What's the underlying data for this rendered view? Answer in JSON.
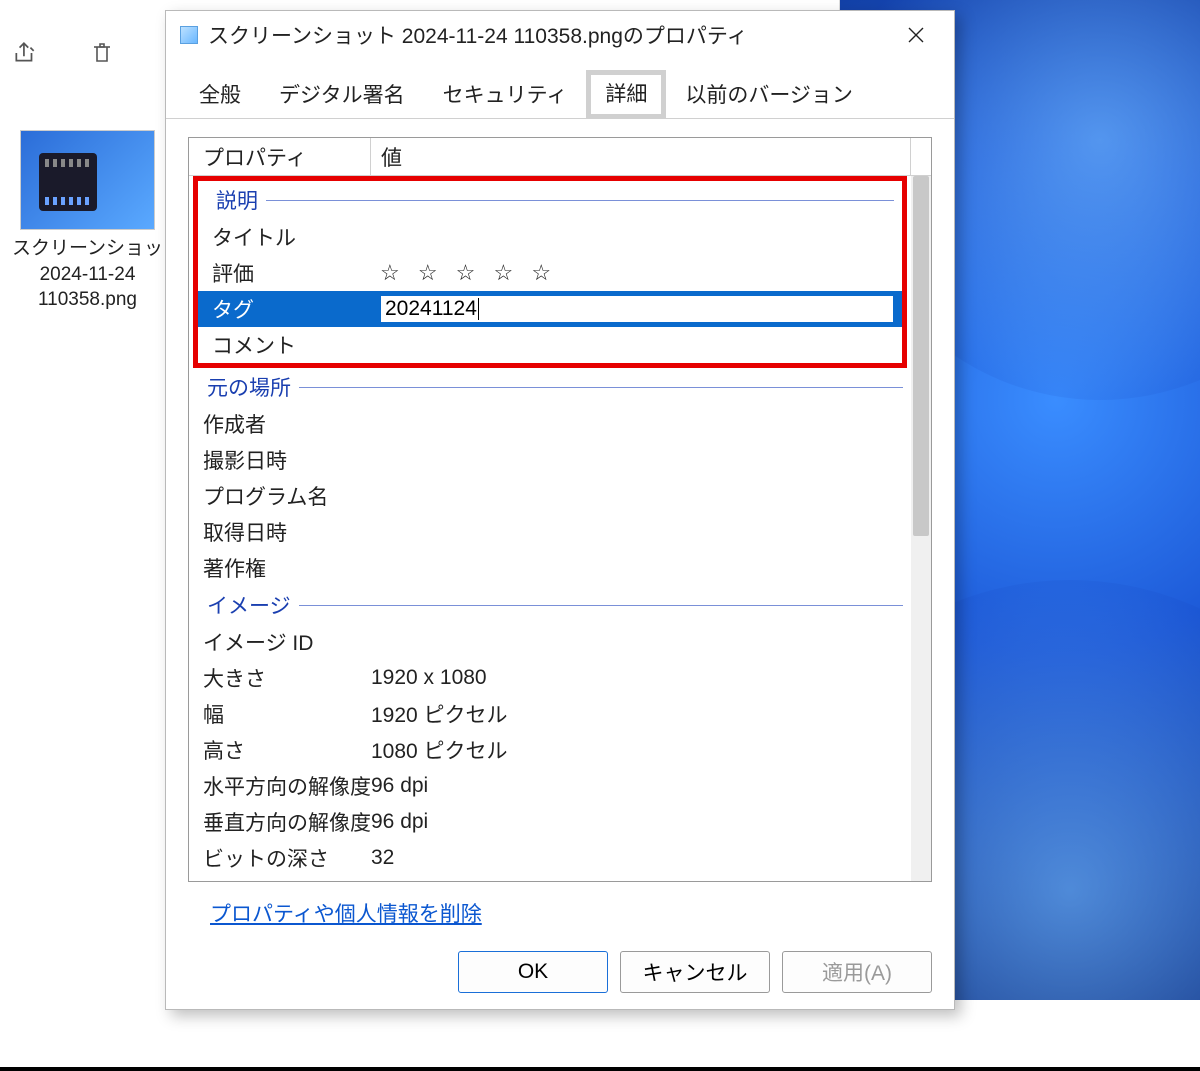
{
  "explorer": {
    "file_label": "スクリーンショッ\n2024-11-24\n110358.png"
  },
  "dialog": {
    "title": "スクリーンショット 2024-11-24 110358.pngのプロパティ",
    "tabs": {
      "general": "全般",
      "digital_signature": "デジタル署名",
      "security": "セキュリティ",
      "details": "詳細",
      "previous_versions": "以前のバージョン"
    },
    "columns": {
      "property": "プロパティ",
      "value": "値"
    },
    "groups": {
      "description": "説明",
      "origin": "元の場所",
      "image": "イメージ"
    },
    "props": {
      "title": "タイトル",
      "rating": "評価",
      "tags": "タグ",
      "tags_value": "20241124",
      "comments": "コメント",
      "authors": "作成者",
      "date_taken": "撮影日時",
      "program_name": "プログラム名",
      "date_acquired": "取得日時",
      "copyright": "著作権",
      "image_id": "イメージ ID",
      "dimensions": "大きさ",
      "dimensions_value": "1920 x 1080",
      "width": "幅",
      "width_value": "1920 ピクセル",
      "height": "高さ",
      "height_value": "1080 ピクセル",
      "hres": "水平方向の解像度",
      "hres_value": "96 dpi",
      "vres": "垂直方向の解像度",
      "vres_value": "96 dpi",
      "bitdepth": "ビットの深さ",
      "bitdepth_value": "32"
    },
    "rating_stars": "☆ ☆ ☆ ☆ ☆",
    "remove_link": "プロパティや個人情報を削除",
    "buttons": {
      "ok": "OK",
      "cancel": "キャンセル",
      "apply": "適用(A)"
    }
  }
}
